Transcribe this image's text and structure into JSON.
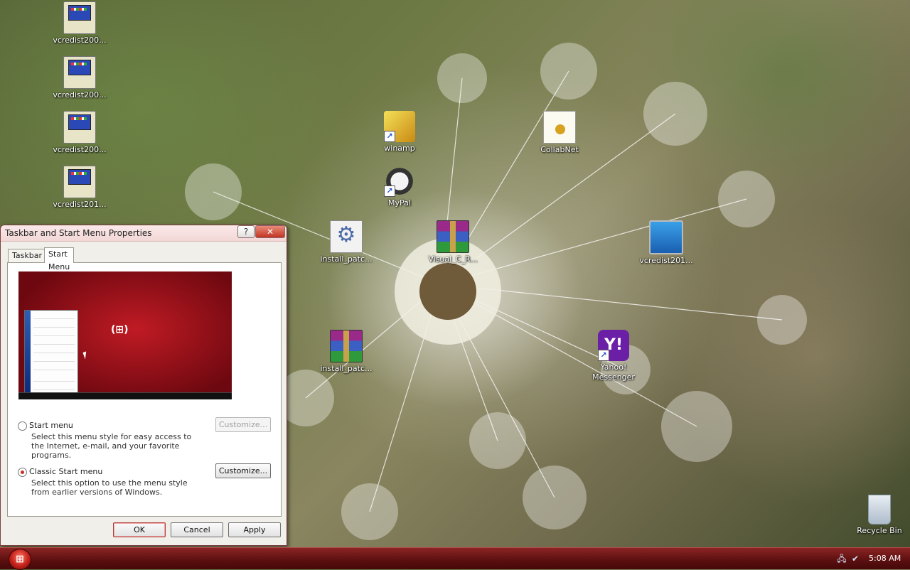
{
  "desktop": {
    "icons": [
      {
        "label": "vcredist200..."
      },
      {
        "label": "vcredist200..."
      },
      {
        "label": "vcredist200..."
      },
      {
        "label": "vcredist201..."
      },
      {
        "label": "winamp"
      },
      {
        "label": "MyPal"
      },
      {
        "label": "CollabNet"
      },
      {
        "label": "install_patc..."
      },
      {
        "label": "Visual_C_R..."
      },
      {
        "label": "vcredist201..."
      },
      {
        "label": "install_patc..."
      },
      {
        "label": "Yahoo! Messenger"
      },
      {
        "label": "Recycle Bin"
      }
    ]
  },
  "dialog": {
    "title": "Taskbar and Start Menu Properties",
    "help_label": "?",
    "close_label": "✕",
    "tabs": [
      {
        "label": "Taskbar"
      },
      {
        "label": "Start Menu"
      }
    ],
    "active_tab": "Start Menu",
    "preview_logo": "(⊞)",
    "options": [
      {
        "label": "Start menu",
        "description": "Select this menu style for easy access to the Internet, e-mail, and your favorite programs.",
        "checked": false,
        "customize_label": "Customize...",
        "customize_enabled": false
      },
      {
        "label": "Classic Start menu",
        "description": "Select this option to use the menu style from earlier versions of Windows.",
        "checked": true,
        "customize_label": "Customize...",
        "customize_enabled": true
      }
    ],
    "buttons": {
      "ok": "OK",
      "cancel": "Cancel",
      "apply": "Apply"
    }
  },
  "taskbar": {
    "start_icon": "windows-orb-icon",
    "tray_icons": [
      "network-icon",
      "safely-remove-icon"
    ],
    "clock": "5:08 AM"
  },
  "colors": {
    "taskbar": "#6e1414",
    "dialog_accent": "#c23421"
  }
}
